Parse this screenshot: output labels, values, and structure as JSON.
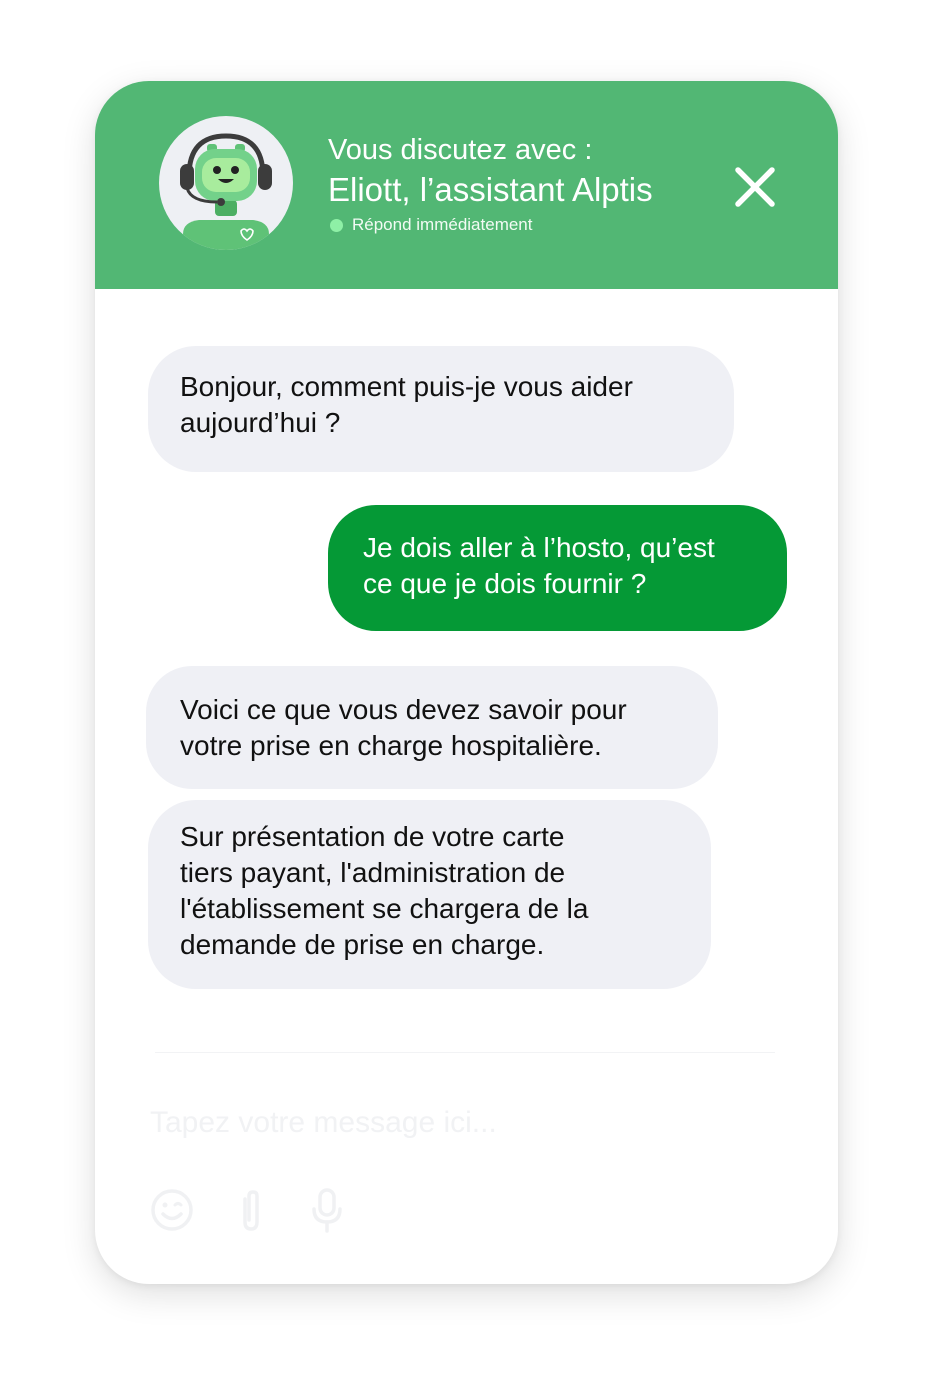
{
  "header": {
    "subtitle": "Vous discutez avec :",
    "title": "Eliott, l’assistant Alptis",
    "status": "Répond immédiatement",
    "avatar_icon": "robot-assistant-icon",
    "close_icon": "close-icon",
    "background_color": "#52b774"
  },
  "messages": [
    {
      "sender": "bot",
      "text": "Bonjour, comment puis-je vous aider\naujourd’hui ?"
    },
    {
      "sender": "user",
      "text": "Je dois aller à l’hosto, qu’est\nce que je dois fournir ?"
    },
    {
      "sender": "bot",
      "text": "Voici ce que vous devez savoir pour\nvotre prise en charge hospitalière."
    },
    {
      "sender": "bot",
      "text": "Sur présentation de votre carte\ntiers payant, l'administration de\nl'établissement se chargera de la\ndemande de prise en charge."
    }
  ],
  "composer": {
    "placeholder": "Tapez votre message ici...",
    "icons": [
      "emoji-icon",
      "paperclip-icon",
      "microphone-icon"
    ]
  },
  "colors": {
    "bot_bubble": "#eff0f5",
    "user_bubble": "#059936",
    "status_dot": "#8ef0a6"
  }
}
